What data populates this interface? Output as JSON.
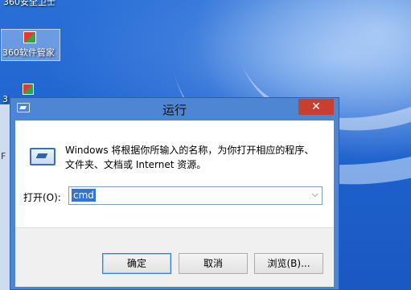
{
  "desktop": {
    "top_icon_label": "360安全卫士",
    "icon_360_label": "360软件管家",
    "partial_label_1": "3",
    "partial_label_2": "F"
  },
  "dialog": {
    "title": "运行",
    "close_glyph": "✕",
    "description": "Windows 将根据你所输入的名称，为你打开相应的程序、文件夹、文档或 Internet 资源。",
    "open_label": "打开(O):",
    "command_value": "cmd",
    "dropdown_glyph": "⌵",
    "ok_label": "确定",
    "cancel_label": "取消",
    "browse_label": "浏览(B)..."
  }
}
